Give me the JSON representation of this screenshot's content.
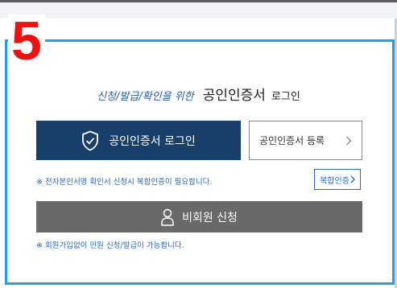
{
  "step_number": "5",
  "heading": {
    "subtitle": "신청/발급/확인을 위한",
    "title": "공인인증서",
    "suffix": "로그인"
  },
  "buttons": {
    "cert_login_label": "공인인증서 로그인",
    "cert_register_label": "공인인증서 등록",
    "multi_auth_label": "복합인증",
    "guest_apply_label": "비회원 신청"
  },
  "notes": {
    "multi_auth_notice": "※ 전자본인서명 확인서 신청시 복합인증이 필요합니다.",
    "guest_notice": "※ 회원가입없이 민원 신청/발급이 가능합니다."
  },
  "colors": {
    "accent_border": "#1da0f0",
    "primary_button": "#183e6a",
    "guest_button": "#6a6a6a",
    "step_number": "#ee1111",
    "notice_text": "#2a67b8"
  },
  "icons": {
    "cert_login": "shield-check-icon",
    "cert_register": "chevron-right-icon",
    "multi_auth": "chevron-right-icon",
    "guest": "person-icon"
  }
}
